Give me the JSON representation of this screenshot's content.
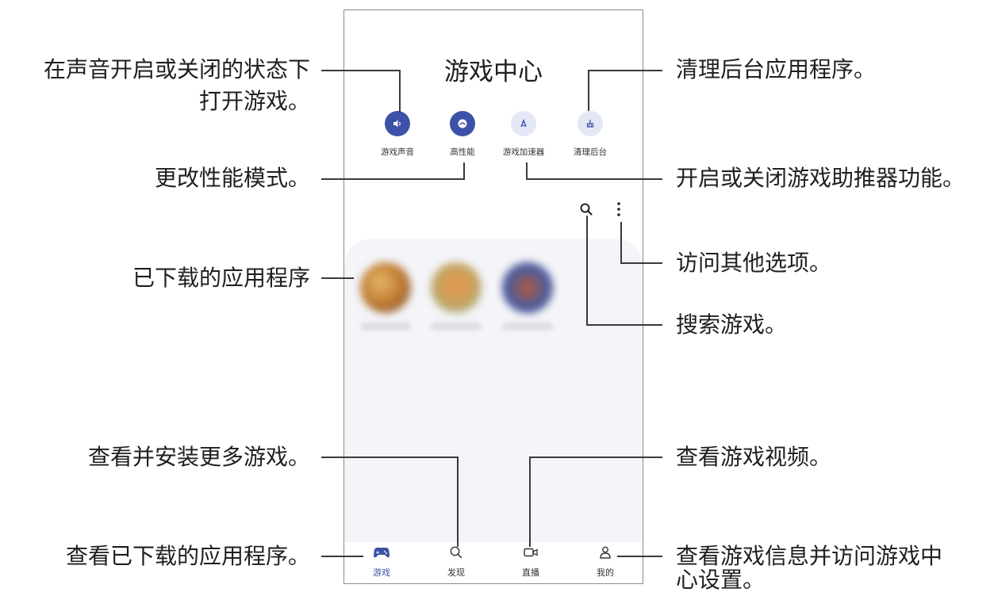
{
  "app": {
    "title": "游戏中心"
  },
  "quick_actions": [
    {
      "label": "游戏声音",
      "icon": "speaker-icon",
      "state": "on"
    },
    {
      "label": "高性能",
      "icon": "performance-icon",
      "state": "on"
    },
    {
      "label": "游戏加速器",
      "icon": "game-booster-icon",
      "state": "off"
    },
    {
      "label": "清理后台",
      "icon": "broom-icon",
      "state": "off"
    }
  ],
  "toolbar": {
    "search_icon": "search-icon",
    "more_icon": "more-vertical-icon"
  },
  "nav": [
    {
      "label": "游戏",
      "icon": "gamepad-icon",
      "active": true
    },
    {
      "label": "发现",
      "icon": "search-icon",
      "active": false
    },
    {
      "label": "直播",
      "icon": "video-camera-icon",
      "active": false
    },
    {
      "label": "我的",
      "icon": "person-icon",
      "active": false
    }
  ],
  "callouts": {
    "sound_1": "在声音开启或关闭的状态下",
    "sound_2": "打开游戏。",
    "perf": "更改性能模式。",
    "downloaded_apps": "已下载的应用程序",
    "install_more": "查看并安装更多游戏。",
    "view_downloaded": "查看已下载的应用程序。",
    "clean_bg": "清理后台应用程序。",
    "booster": "开启或关闭游戏助推器功能。",
    "more_options": "访问其他选项。",
    "search_games": "搜索游戏。",
    "videos": "查看游戏视频。",
    "info_1": "查看游戏信息并访问游戏中",
    "info_2": "心设置。"
  },
  "colors": {
    "accent": "#3e51a8",
    "inactive_btn": "#e3e7f6",
    "game_area": "#f4f5f9"
  }
}
